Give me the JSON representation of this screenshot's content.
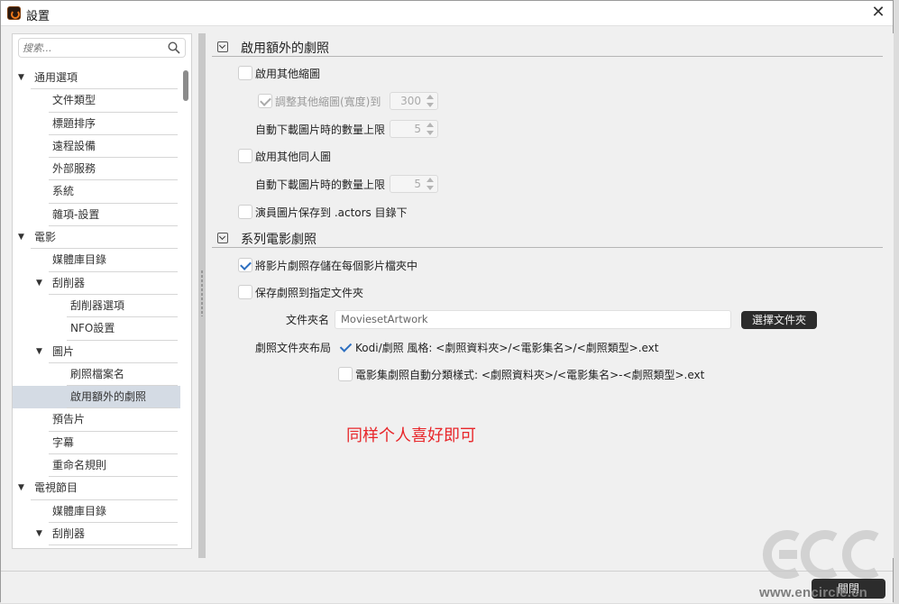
{
  "window": {
    "title": "設置",
    "close_glyph": "✕"
  },
  "sidebar": {
    "search_placeholder": "搜索...",
    "items": [
      {
        "label": "通用選項",
        "level": 0,
        "expanded": true
      },
      {
        "label": "文件類型",
        "level": 1
      },
      {
        "label": "標題排序",
        "level": 1
      },
      {
        "label": "遠程設備",
        "level": 1
      },
      {
        "label": "外部服務",
        "level": 1
      },
      {
        "label": "系統",
        "level": 1
      },
      {
        "label": "雜項-設置",
        "level": 1
      },
      {
        "label": "電影",
        "level": 0,
        "expanded": true
      },
      {
        "label": "媒體庫目錄",
        "level": 1
      },
      {
        "label": "刮削器",
        "level": 1,
        "expanded": true
      },
      {
        "label": "刮削器選項",
        "level": 2
      },
      {
        "label": "NFO設置",
        "level": 2
      },
      {
        "label": "圖片",
        "level": 1,
        "expanded": true
      },
      {
        "label": "刷照檔案名",
        "level": 2
      },
      {
        "label": "啟用額外的劇照",
        "level": 2,
        "selected": true
      },
      {
        "label": "預告片",
        "level": 1
      },
      {
        "label": "字幕",
        "level": 1
      },
      {
        "label": "重命名規則",
        "level": 1
      },
      {
        "label": "電視節目",
        "level": 0,
        "expanded": true
      },
      {
        "label": "媒體庫目錄",
        "level": 1
      },
      {
        "label": "刮削器",
        "level": 1,
        "expanded": true
      }
    ]
  },
  "section1": {
    "title": "啟用額外的劇照",
    "enable_thumbs": {
      "label": "啟用其他縮圖",
      "checked": false
    },
    "resize_thumbs": {
      "label": "調整其他縮圖(寬度)到",
      "checked": true,
      "value": "300"
    },
    "thumb_limit": {
      "label": "自動下載圖片時的數量上限",
      "value": "5"
    },
    "enable_actor_images": {
      "label": "啟用其他同人圖",
      "checked": false
    },
    "actor_limit": {
      "label": "自動下載圖片時的數量上限",
      "value": "5"
    },
    "save_actors": {
      "label": "演員圖片保存到 .actors 目錄下",
      "checked": false
    }
  },
  "section2": {
    "title": "系列電影劇照",
    "save_in_movie_folder": {
      "label": "將影片劇照存儲在每個影片檔夾中",
      "checked": true
    },
    "save_to_folder": {
      "label": "保存劇照到指定文件夾",
      "checked": false
    },
    "folder_name_label": "文件夾名",
    "folder_name_value": "MoviesetArtwork",
    "choose_folder_button": "選擇文件夾",
    "layout_label": "劇照文件夾布局",
    "layout_kodi": {
      "label": "Kodi/劇照 風格: <劇照資料夾>/<電影集名>/<劇照類型>.ext",
      "checked": true
    },
    "layout_auto": {
      "label": "電影集劇照自動分類樣式: <劇照資料夾>/<電影集名>-<劇照類型>.ext",
      "checked": false
    }
  },
  "annotation": "同样个人喜好即可",
  "footer": {
    "close_button": "關閉"
  },
  "watermark": {
    "logo": "ECC",
    "url": "www.encircle.cn"
  },
  "colors": {
    "selected_row": "#d4dbe4",
    "check_blue": "#2d6fc0",
    "annotation_red": "#e8262a",
    "dark_button": "#2c2c2c"
  }
}
